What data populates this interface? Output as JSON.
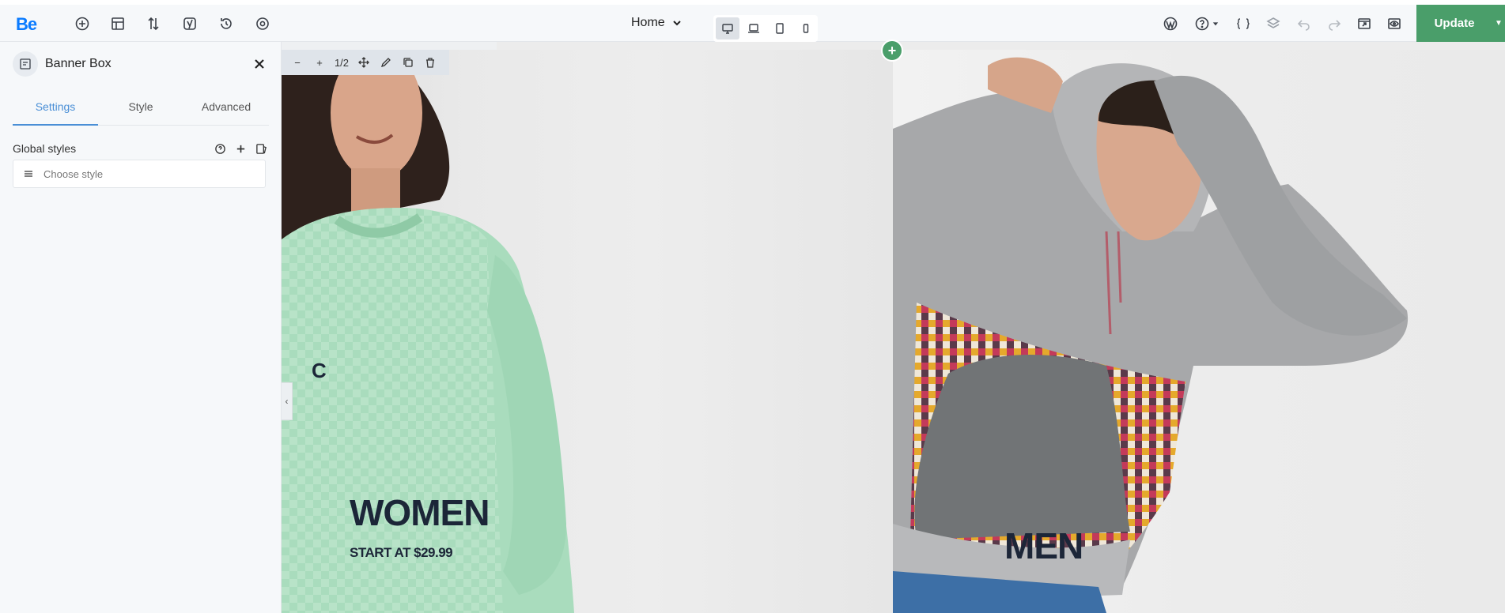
{
  "topbar": {
    "logo": "Be",
    "page": "Home",
    "update_label": "Update",
    "icons": [
      "add-circle-icon",
      "layout-icon",
      "sort-icon",
      "yoast-icon",
      "history-icon",
      "settings-icon"
    ],
    "right_icons": [
      "wordpress-icon",
      "help-icon",
      "css-icon",
      "layers-icon",
      "undo-icon",
      "redo-icon",
      "preview-icon",
      "eye-icon"
    ],
    "devices": [
      "desktop",
      "laptop",
      "tablet",
      "mobile"
    ]
  },
  "panel": {
    "title": "Banner Box",
    "tabs": [
      {
        "label": "Settings",
        "active": true
      },
      {
        "label": "Style",
        "active": false
      },
      {
        "label": "Advanced",
        "active": false
      }
    ],
    "global_styles_label": "Global styles",
    "choose_style_placeholder": "Choose style"
  },
  "edit_toolbar": {
    "counter": "1/2"
  },
  "canvas": {
    "women": {
      "heading": "WOMEN",
      "subheading": "START AT $29.99"
    },
    "men": {
      "heading": "MEN"
    }
  },
  "colors": {
    "accent_green": "#4a9e6a",
    "logo_blue": "#0a7bff",
    "active_tab": "#4a8fd6",
    "heading_text": "#1c2638"
  }
}
